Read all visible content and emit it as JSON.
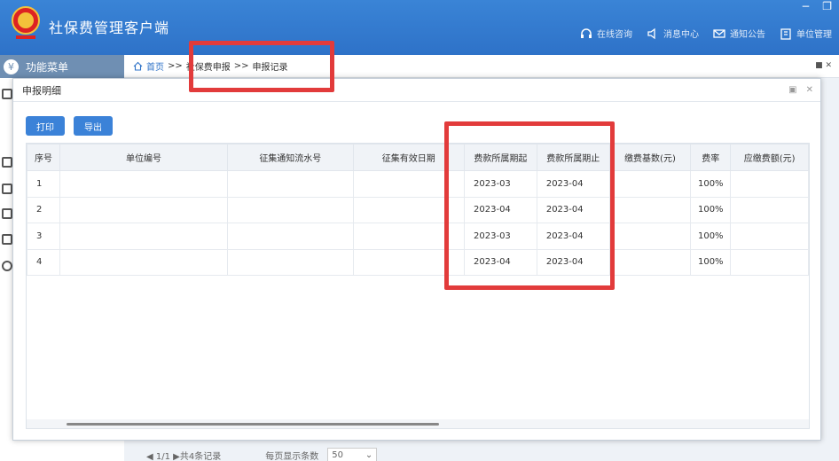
{
  "app": {
    "title": "社保费管理客户端",
    "win_controls": [
      "−",
      "❐"
    ]
  },
  "top_nav": [
    {
      "label": "在线咨询",
      "icon": "headset-icon"
    },
    {
      "label": "消息中心",
      "icon": "speaker-icon"
    },
    {
      "label": "通知公告",
      "icon": "mail-icon"
    },
    {
      "label": "单位管理",
      "icon": "building-icon"
    }
  ],
  "side_menu": {
    "title": "功能菜单"
  },
  "breadcrumb": {
    "home": "首页",
    "sep": ">>",
    "level1": "社保费申报",
    "level2": "申报记录"
  },
  "dialog": {
    "title": "申报明细",
    "buttons": {
      "print": "打印",
      "export": "导出"
    },
    "columns": [
      "序号",
      "单位编号",
      "征集通知流水号",
      "征集有效日期",
      "费款所属期起",
      "费款所属期止",
      "缴费基数(元)",
      "费率",
      "应缴费额(元)"
    ],
    "rows": [
      {
        "no": "1",
        "unit_id": "",
        "notice_no": "",
        "valid_date": "",
        "period_start": "2023-03",
        "period_end": "2023-04",
        "base": "",
        "rate": "100%",
        "amount": ""
      },
      {
        "no": "2",
        "unit_id": "",
        "notice_no": "",
        "valid_date": "",
        "period_start": "2023-04",
        "period_end": "2023-04",
        "base": "",
        "rate": "100%",
        "amount": ""
      },
      {
        "no": "3",
        "unit_id": "",
        "notice_no": "",
        "valid_date": "",
        "period_start": "2023-03",
        "period_end": "2023-04",
        "base": "",
        "rate": "100%",
        "amount": ""
      },
      {
        "no": "4",
        "unit_id": "",
        "notice_no": "",
        "valid_date": "",
        "period_start": "2023-04",
        "period_end": "2023-04",
        "base": "",
        "rate": "100%",
        "amount": ""
      }
    ]
  },
  "pager": {
    "info": "◀ 1/1 ▶共4条记录",
    "per_page_label": "每页显示条数",
    "per_page": "50"
  },
  "colors": {
    "header": "#2e72c8",
    "button": "#3b82d8",
    "highlight": "#e23b3b"
  }
}
